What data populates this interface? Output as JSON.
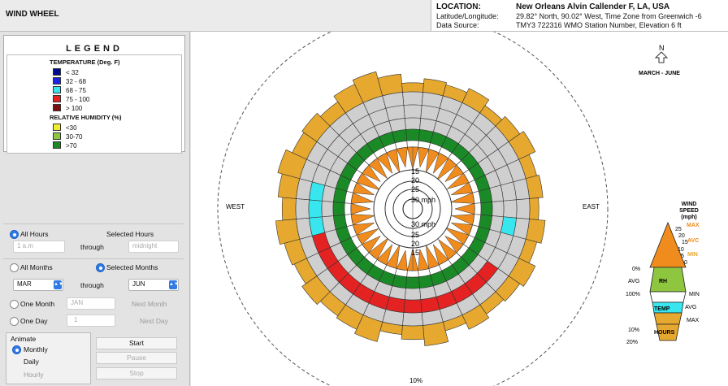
{
  "app": {
    "title": "WIND WHEEL"
  },
  "location": {
    "label": "LOCATION:",
    "name": "New Orleans Alvin Callender F, LA, USA",
    "latlon_label": "Latitude/Longitude:",
    "latlon_value": "29.82° North, 90.02° West, Time Zone from Greenwich -6",
    "source_label": "Data Source:",
    "source_value": "TMY3     722316 WMO Station Number, Elevation 6 ft"
  },
  "legend": {
    "title": "LEGEND",
    "temperature_heading": "TEMPERATURE (Deg. F)",
    "temperature": [
      {
        "label": "< 32",
        "color": "#000a8e"
      },
      {
        "label": "32  -  68",
        "color": "#1a23e6"
      },
      {
        "label": "68  -  75",
        "color": "#37e6ef"
      },
      {
        "label": "75  -  100",
        "color": "#e42222"
      },
      {
        "label": "> 100",
        "color": "#7d0f0f"
      }
    ],
    "humidity_heading": "RELATIVE HUMIDITY (%)",
    "humidity": [
      {
        "label": "<30",
        "color": "#eeee2a"
      },
      {
        "label": "30-70",
        "color": "#8ec63f"
      },
      {
        "label": ">70",
        "color": "#1a8a26"
      }
    ]
  },
  "controls": {
    "all_hours": "All Hours",
    "selected_hours": "Selected Hours",
    "hours_from": "1 a.m",
    "hours_through": "through",
    "hours_to": "midnight",
    "all_months": "All Months",
    "selected_months": "Selected Months",
    "month_from": "MAR",
    "month_through": "through",
    "month_to": "JUN",
    "one_month": "One Month",
    "one_month_value": "JAN",
    "next_month": "Next Month",
    "one_day": "One Day",
    "one_day_value": "1",
    "next_day": "Next Day",
    "animate": "Animate",
    "monthly": "Monthly",
    "daily": "Daily",
    "hourly": "Hourly",
    "start": "Start",
    "pause": "Pause",
    "stop": "Stop"
  },
  "wheel": {
    "north": "N",
    "period": "MARCH - JUNE",
    "west": "WEST",
    "east": "EAST",
    "outer_percent": "10%",
    "rings_up": [
      "15",
      "20",
      "25",
      "30 mph"
    ],
    "rings_down": [
      "30 mph",
      "25",
      "20",
      "15"
    ]
  },
  "key": {
    "title_line1": "WIND",
    "title_line2": "SPEED",
    "title_line3": "(mph)",
    "speed_ticks": [
      "25",
      "20",
      "15",
      "10",
      "5",
      "0"
    ],
    "max": "MAX",
    "avc": "AVC",
    "min_label": "MIN",
    "rh_pct0": "0%",
    "rh_avg": "AVG",
    "rh": "RH",
    "rh_pct100": "100%",
    "rh_min": "MIN",
    "temp": "TEMP",
    "temp_avg": "AVG",
    "temp_max": "MAX",
    "hours_pct10": "10%",
    "hours": "HOURS",
    "hours_pct20": "20%"
  },
  "colors": {
    "orange": "#f08c1e",
    "gold": "#e6a82e",
    "gray": "#cfcfcf",
    "blue": "#1a23e6",
    "cyan": "#37e6ef",
    "red": "#e42222",
    "green": "#1a8a26",
    "lightgreen": "#8ec63f",
    "yellow": "#eeee2a"
  },
  "chart_data": {
    "type": "wind-rose",
    "directions": 36,
    "hours_percent": [
      2.0,
      3.0,
      2.5,
      3.5,
      2.0,
      3.0,
      4.0,
      2.5,
      3.0,
      2.0,
      3.5,
      2.5,
      4.0,
      3.0,
      2.5,
      3.5,
      2.0,
      4.5,
      3.0,
      2.0,
      4.5,
      3.5,
      3.0,
      4.0,
      3.0,
      3.5,
      4.5,
      3.0,
      4.0,
      5.0,
      3.5,
      4.0,
      3.0,
      4.5,
      5.5,
      4.0
    ],
    "temperature_band": [
      "gray",
      "gray",
      "gray",
      "gray",
      "gray",
      "gray",
      "gray",
      "gray",
      "gray",
      "gray",
      "cyan",
      "gray",
      "gray",
      "red",
      "red",
      "red",
      "red",
      "red",
      "red",
      "red",
      "red",
      "red",
      "red",
      "red",
      "red",
      "red",
      "cyan",
      "cyan",
      "cyan",
      "gray",
      "gray",
      "gray",
      "gray",
      "gray",
      "gray",
      "gray"
    ],
    "humidity_band": "green",
    "wind_speed_avg_mph": [
      17,
      15,
      18,
      16,
      19,
      15,
      17,
      16,
      18,
      15,
      17,
      16,
      19,
      15,
      17,
      16,
      18,
      16,
      17,
      15,
      18,
      16,
      19,
      15,
      17,
      16,
      18,
      15,
      17,
      16,
      19,
      15,
      17,
      16,
      18,
      15
    ]
  }
}
